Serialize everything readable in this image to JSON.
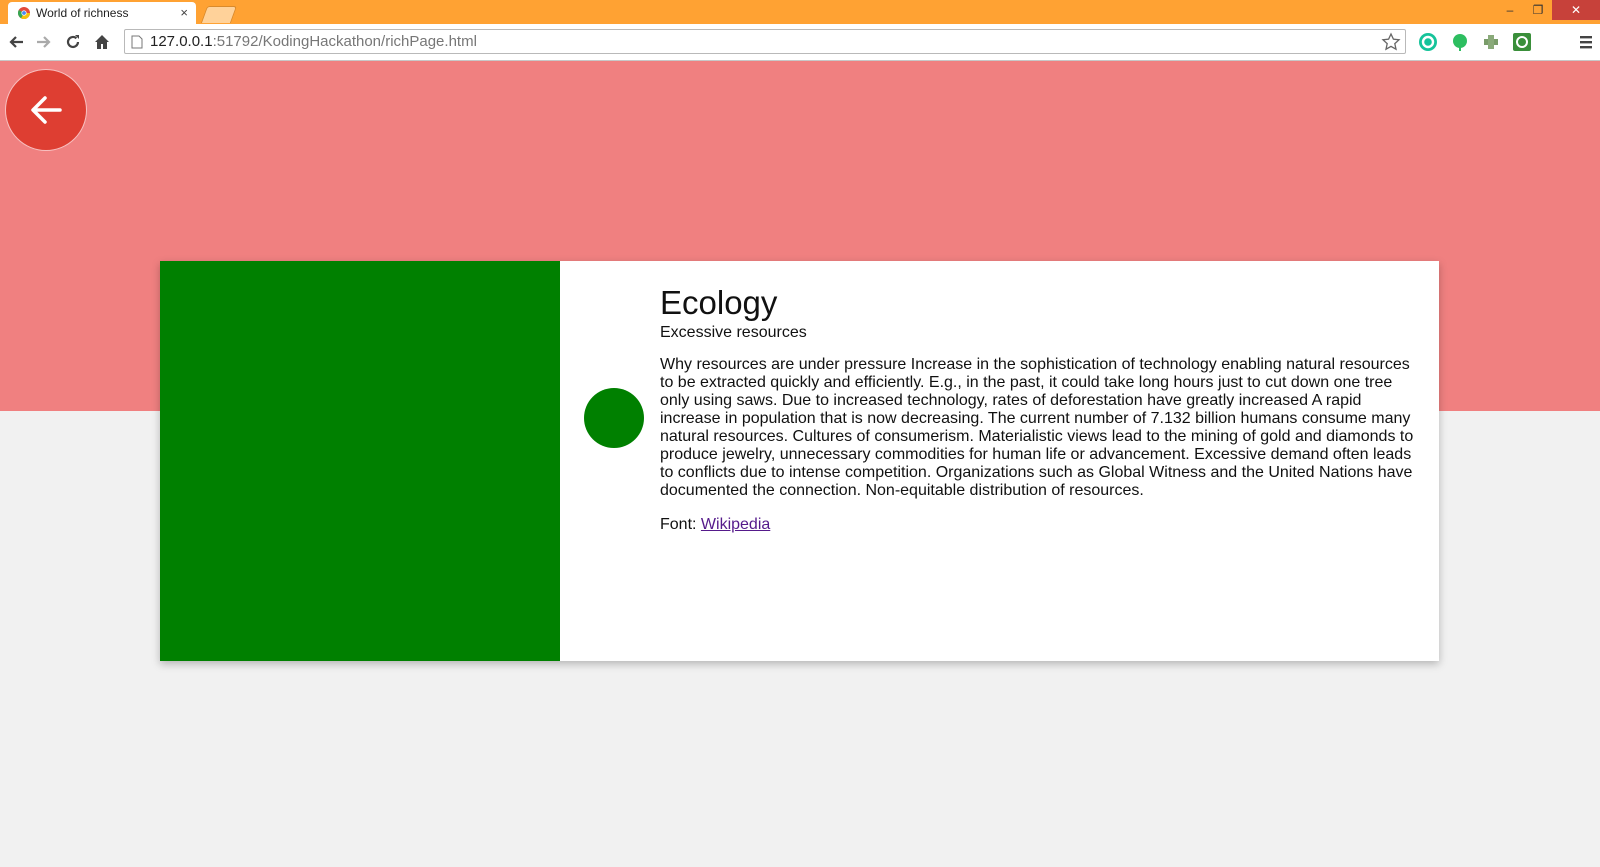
{
  "browser": {
    "tab_title": "World of richness",
    "tab_close": "×",
    "url_host": "127.0.0.1",
    "url_rest": ":51792/KodingHackathon/richPage.html",
    "window_controls": {
      "minimize": "–",
      "maximize": "❐",
      "close": "✕"
    }
  },
  "page": {
    "colors": {
      "hero": "#f08080",
      "accent": "#008000",
      "back_button": "#de3e32"
    },
    "card": {
      "title": "Ecology",
      "subtitle": "Excessive resources",
      "body": "Why resources are under pressure Increase in the sophistication of technology enabling natural resources to be extracted quickly and efficiently. E.g., in the past, it could take long hours just to cut down one tree only using saws. Due to increased technology, rates of deforestation have greatly increased A rapid increase in population that is now decreasing. The current number of 7.132 billion humans consume many natural resources. Cultures of consumerism. Materialistic views lead to the mining of gold and diamonds to produce jewelry, unnecessary commodities for human life or advancement. Excessive demand often leads to conflicts due to intense competition. Organizations such as Global Witness and the United Nations have documented the connection. Non-equitable distribution of resources.",
      "source_label": "Font:",
      "source_link": "Wikipedia"
    }
  }
}
